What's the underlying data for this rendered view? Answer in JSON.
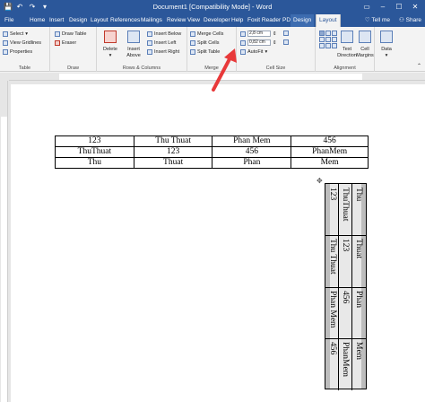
{
  "window": {
    "title": "Document1 [Compatibility Mode] - Word",
    "qat": [
      "💾",
      "↶",
      "↷",
      "▾"
    ],
    "controls": [
      "▭",
      "–",
      "☐",
      "✕"
    ]
  },
  "tabs": [
    "File",
    "Home",
    "Insert",
    "Design",
    "Layout",
    "References",
    "Mailings",
    "Review",
    "View",
    "Developer",
    "Help",
    "Foxit Reader PDF",
    "Design",
    "Layout"
  ],
  "tabs_right": {
    "tell_me": "Tell me",
    "share": "Share"
  },
  "ribbon": {
    "table_group": {
      "label": "Table",
      "select": "Select",
      "view_gridlines": "View Gridlines",
      "properties": "Properties"
    },
    "draw_group": {
      "label": "Draw",
      "draw_table": "Draw Table",
      "eraser": "Eraser"
    },
    "rows_cols_group": {
      "label": "Rows & Columns",
      "delete": "Delete",
      "insert_above_1": "Insert",
      "insert_above_2": "Above",
      "insert_below": "Insert Below",
      "insert_left": "Insert Left",
      "insert_right": "Insert Right"
    },
    "merge_group": {
      "label": "Merge",
      "merge_cells": "Merge Cells",
      "split_cells": "Split Cells",
      "split_table": "Split Table"
    },
    "cell_size_group": {
      "label": "Cell Size",
      "height": "2,8 cm",
      "width": "0,82 cm",
      "autofit": "AutoFit"
    },
    "alignment_group": {
      "label": "Alignment",
      "text_direction_1": "Text",
      "text_direction_2": "Direction",
      "cell_margins_1": "Cell",
      "cell_margins_2": "Margins"
    },
    "data_group": {
      "label": "Data"
    }
  },
  "table1": [
    [
      "123",
      "Thu Thuat",
      "Phan Mem",
      "456"
    ],
    [
      "ThuThuat",
      "123",
      "456",
      "PhanMem"
    ],
    [
      "Thu",
      "Thuat",
      "Phan",
      "Mem"
    ]
  ],
  "table2": [
    [
      "123",
      "ThuThuat",
      "Thu"
    ],
    [
      "Thu Thuat",
      "123",
      "Thuat"
    ],
    [
      "Phan Mem",
      "456",
      "Phan"
    ],
    [
      "456",
      "PhanMem",
      "Mem"
    ]
  ],
  "colors": {
    "accent": "#2b579a",
    "arrow": "#e8393a"
  }
}
